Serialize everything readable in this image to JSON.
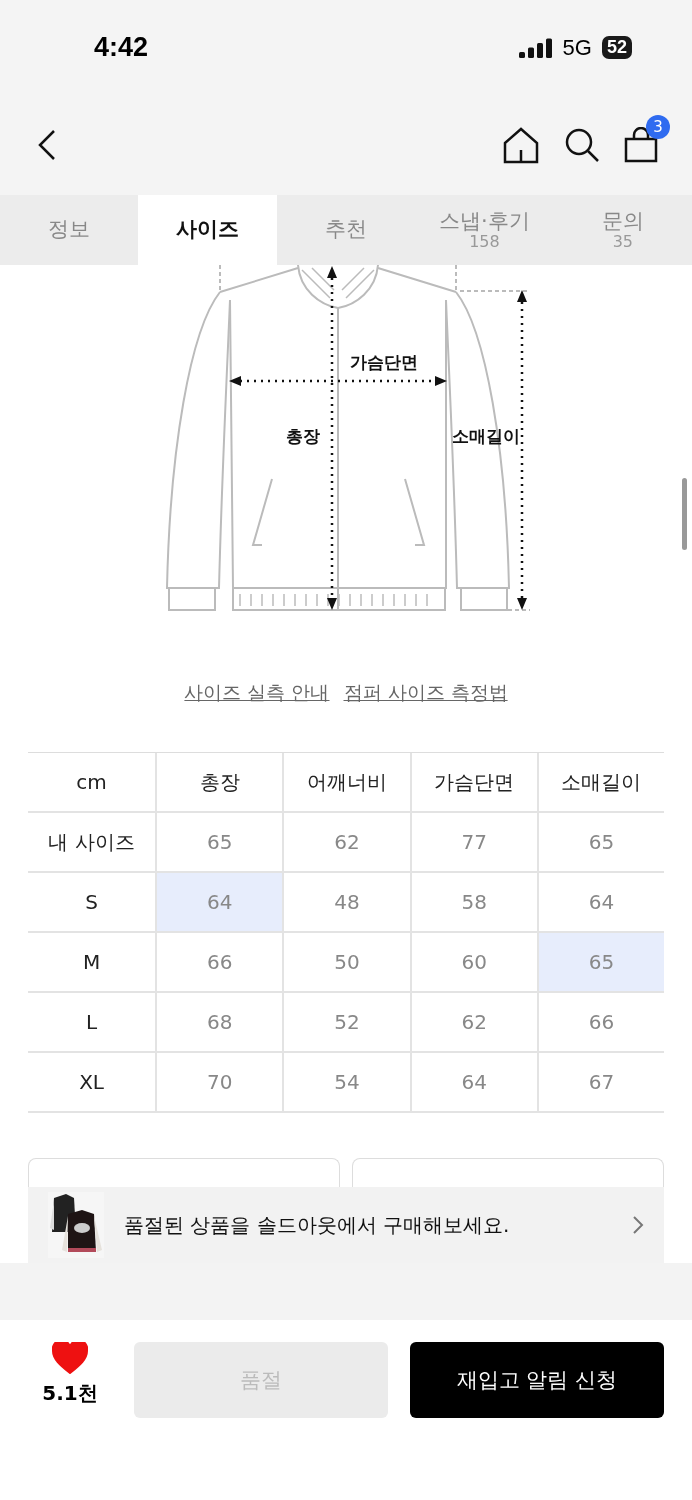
{
  "status_bar": {
    "time": "4:42",
    "network": "5G",
    "battery": "52"
  },
  "nav": {
    "cart_count": "3"
  },
  "tabs": [
    {
      "label": "정보",
      "selected": false
    },
    {
      "label": "사이즈",
      "selected": true
    },
    {
      "label": "추천",
      "selected": false
    },
    {
      "label": "스냅·후기",
      "count": "158",
      "selected": false
    },
    {
      "label": "문의",
      "count": "35",
      "selected": false
    }
  ],
  "diagram": {
    "labels": [
      "가슴단면",
      "총장",
      "소매길이"
    ]
  },
  "guide_links": [
    "사이즈 실측 안내",
    "점퍼 사이즈 측정법"
  ],
  "size_table": {
    "corner": "cm",
    "columns": [
      "총장",
      "어깨너비",
      "가슴단면",
      "소매길이"
    ],
    "rows": [
      {
        "label": "내 사이즈",
        "cells": [
          {
            "value": "65",
            "highlighted": false
          },
          {
            "value": "62",
            "highlighted": false
          },
          {
            "value": "77",
            "highlighted": false
          },
          {
            "value": "65",
            "highlighted": false
          }
        ]
      },
      {
        "label": "S",
        "cells": [
          {
            "value": "64",
            "highlighted": true
          },
          {
            "value": "48",
            "highlighted": false
          },
          {
            "value": "58",
            "highlighted": false
          },
          {
            "value": "64",
            "highlighted": false
          }
        ]
      },
      {
        "label": "M",
        "cells": [
          {
            "value": "66",
            "highlighted": false
          },
          {
            "value": "50",
            "highlighted": false
          },
          {
            "value": "60",
            "highlighted": false
          },
          {
            "value": "65",
            "highlighted": true
          }
        ]
      },
      {
        "label": "L",
        "cells": [
          {
            "value": "68",
            "highlighted": false
          },
          {
            "value": "52",
            "highlighted": false
          },
          {
            "value": "62",
            "highlighted": false
          },
          {
            "value": "66",
            "highlighted": false
          }
        ]
      },
      {
        "label": "XL",
        "cells": [
          {
            "value": "70",
            "highlighted": false
          },
          {
            "value": "54",
            "highlighted": false
          },
          {
            "value": "64",
            "highlighted": false
          },
          {
            "value": "67",
            "highlighted": false
          }
        ]
      }
    ]
  },
  "soldout_banner": {
    "text": "품절된 상품을 솔드아웃에서 구매해보세요."
  },
  "bottom_bar": {
    "like_count": "5.1천",
    "liked": true,
    "soldout_button": "품절",
    "restock_button": "재입고 알림 신청"
  }
}
